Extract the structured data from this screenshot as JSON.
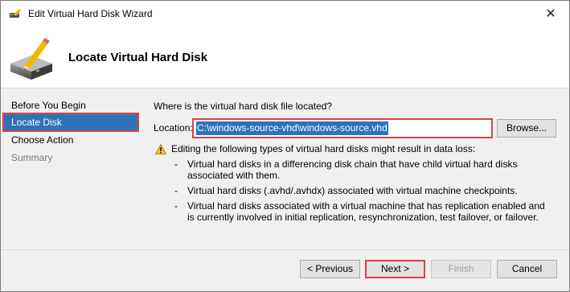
{
  "window": {
    "title": "Edit Virtual Hard Disk Wizard",
    "close_glyph": "✕"
  },
  "header": {
    "title": "Locate Virtual Hard Disk"
  },
  "nav": {
    "items": [
      {
        "label": "Before You Begin",
        "state": "normal"
      },
      {
        "label": "Locate Disk",
        "state": "selected"
      },
      {
        "label": "Choose Action",
        "state": "normal"
      },
      {
        "label": "Summary",
        "state": "disabled"
      }
    ]
  },
  "content": {
    "question": "Where is the virtual hard disk file located?",
    "location_label": "Location:",
    "location_value": "C:\\windows-source-vhd\\windows-source.vhd",
    "browse_label": "Browse...",
    "warning_text": "Editing the following types of virtual hard disks might result in data loss:",
    "warning_items": [
      "Virtual hard disks in a differencing disk chain that have child virtual hard disks associated with them.",
      "Virtual hard disks (.avhd/.avhdx) associated with virtual machine checkpoints.",
      "Virtual hard disks associated with a virtual machine that has replication enabled and is currently involved in initial replication, resynchronization, test failover, or failover."
    ],
    "dash": "-"
  },
  "footer": {
    "previous_label": "< Previous",
    "next_label": "Next >",
    "finish_label": "Finish",
    "cancel_label": "Cancel"
  },
  "icons": {
    "title_icon": "disk-pencil-icon",
    "header_icon": "disk-pencil-icon",
    "warning_icon": "warning-triangle-icon"
  },
  "colors": {
    "selection": "#2f72b7",
    "highlight_border": "#d9404a",
    "warning": "#f5c518"
  }
}
